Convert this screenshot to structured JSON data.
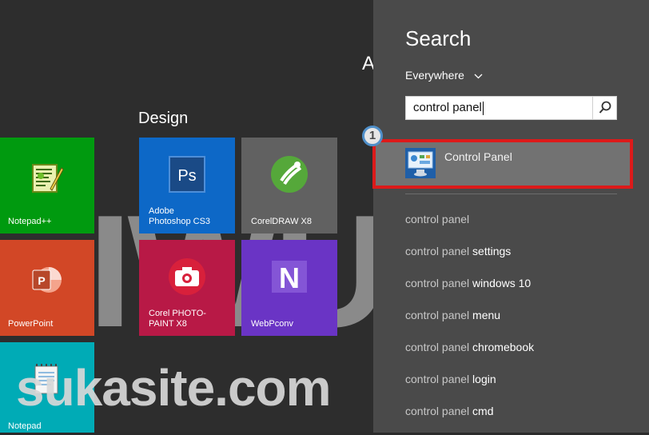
{
  "start_screen": {
    "cut_off_group_letter": "A",
    "group_title": "Design",
    "tiles": [
      {
        "id": "notepadpp",
        "label": "Notepad++",
        "color": "#009a0f"
      },
      {
        "id": "powerpoint",
        "label": "PowerPoint",
        "color": "#d24726"
      },
      {
        "id": "notepad",
        "label": "Notepad",
        "color": "#00abb6"
      },
      {
        "id": "photoshop",
        "label": "Adobe\nPhotoshop CS3",
        "color": "#0d68c7"
      },
      {
        "id": "coreldraw",
        "label": "CorelDRAW X8",
        "color": "#616161"
      },
      {
        "id": "photopaint",
        "label": "Corel PHOTO-\nPAINT X8",
        "color": "#b81946"
      },
      {
        "id": "webpconv",
        "label": "WebPconv",
        "color": "#6a34c5"
      }
    ],
    "icon_texts": {
      "photoshop": "Ps",
      "webpconv": "N"
    }
  },
  "watermark": {
    "big_text": "IWU C",
    "site_text": "sukasite.com"
  },
  "search_panel": {
    "title": "Search",
    "scope": "Everywhere",
    "query": "control panel",
    "search_icon": "magnifier-icon",
    "step_badge": "1",
    "top_result": {
      "label": "Control Panel",
      "icon": "control-panel-icon"
    },
    "highlight_color": "#dc1a1a",
    "suggestions": [
      {
        "query": "control panel",
        "rest": ""
      },
      {
        "query": "control panel",
        "rest": " settings"
      },
      {
        "query": "control panel",
        "rest": " windows 10"
      },
      {
        "query": "control panel",
        "rest": " menu"
      },
      {
        "query": "control panel",
        "rest": " chromebook"
      },
      {
        "query": "control panel",
        "rest": " login"
      },
      {
        "query": "control panel",
        "rest": " cmd"
      }
    ]
  }
}
